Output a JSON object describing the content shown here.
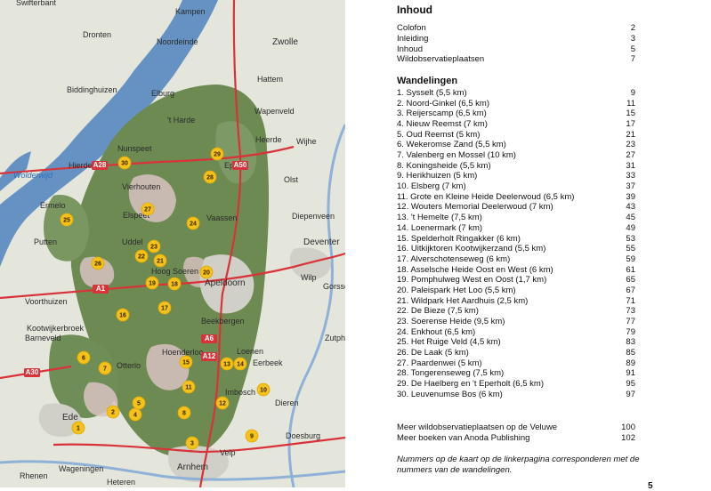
{
  "map": {
    "places": [
      "Swifterbant",
      "Kampen",
      "Dronten",
      "Noordeinde",
      "Zwolle",
      "Biddinghuizen",
      "Elburg",
      "Hattem",
      "'t Harde",
      "Wapenveld",
      "Nunspeet",
      "Heerde",
      "Wijhe",
      "Hierden",
      "Epe",
      "Wolderwijd",
      "Vierhouten",
      "Olst",
      "Ermelo",
      "Elspeet",
      "Vaassen",
      "Diepenveen",
      "Putten",
      "Uddel",
      "Deventer",
      "Hoog Soeren",
      "Apeldoorn",
      "Wilp",
      "Voorthuizen",
      "Gorsse",
      "Beekbergen",
      "Kootwijkerbroek",
      "Barneveld",
      "Hoenderloo",
      "Loenen",
      "Zutph",
      "Eerbeek",
      "Otterlo",
      "Imbosch",
      "Dieren",
      "Ede",
      "Doesburg",
      "Velp",
      "Wageningen",
      "Arnhem",
      "Rhenen",
      "Heteren"
    ],
    "roads": [
      "A28",
      "A50",
      "A1",
      "A30",
      "A12",
      "A6"
    ],
    "markers": [
      "1",
      "2",
      "3",
      "4",
      "5",
      "6",
      "7",
      "8",
      "9",
      "10",
      "11",
      "12",
      "13",
      "14",
      "15",
      "16",
      "17",
      "18",
      "19",
      "20",
      "21",
      "22",
      "23",
      "24",
      "25",
      "26",
      "27",
      "28",
      "29",
      "30"
    ],
    "colors": {
      "marker": "#f4c21b",
      "forest": "#6d8a53",
      "heath": "#d9c2c2",
      "water": "#4f82bd",
      "road": "#d9333a"
    }
  },
  "toc": {
    "title": "Inhoud",
    "front": [
      {
        "label": "Colofon",
        "page": "2"
      },
      {
        "label": "Inleiding",
        "page": "3"
      },
      {
        "label": "Inhoud",
        "page": "5"
      },
      {
        "label": "Wildobservatieplaatsen",
        "page": "7"
      }
    ],
    "walks_title": "Wandelingen",
    "walks": [
      {
        "label": "1. Sysselt (5,5 km)",
        "page": "9"
      },
      {
        "label": "2. Noord-Ginkel (6,5 km)",
        "page": "11"
      },
      {
        "label": "3. Reijerscamp (6,5 km)",
        "page": "15"
      },
      {
        "label": "4. Nieuw Reemst (7 km)",
        "page": "17"
      },
      {
        "label": "5. Oud Reemst  (5 km)",
        "page": "21"
      },
      {
        "label": "6. Wekeromse Zand (5,5 km)",
        "page": "23"
      },
      {
        "label": "7. Valenberg en Mossel (10 km)",
        "page": "27"
      },
      {
        "label": "8. Koningsheide (5,5 km)",
        "page": "31"
      },
      {
        "label": "9. Herikhuizen (5 km)",
        "page": "33"
      },
      {
        "label": "10. Elsberg (7 km)",
        "page": "37"
      },
      {
        "label": "11. Grote en Kleine Heide Deelerwoud (6,5 km)",
        "page": "39"
      },
      {
        "label": "12. Wouters Memorial Deelerwoud (7 km)",
        "page": "43"
      },
      {
        "label": "13. 't Hemelte (7,5 km)",
        "page": "45"
      },
      {
        "label": "14. Loenermark (7 km)",
        "page": "49"
      },
      {
        "label": "15. Spelderholt Ringakker (6 km)",
        "page": "53"
      },
      {
        "label": "16. Uitkijktoren Kootwijkerzand (5,5 km)",
        "page": "55"
      },
      {
        "label": "17. Alverschotenseweg (6 km)",
        "page": "59"
      },
      {
        "label": "18. Asselsche Heide Oost en West (6 km)",
        "page": "61"
      },
      {
        "label": "19. Pomphulweg West en Oost (1,7 km)",
        "page": "65"
      },
      {
        "label": "20. Paleispark Het Loo (5,5 km)",
        "page": "67"
      },
      {
        "label": "21. Wildpark Het Aardhuis (2,5 km)",
        "page": "71"
      },
      {
        "label": "22. De Bieze (7,5 km)",
        "page": "73"
      },
      {
        "label": "23. Soerense Heide (9,5 km)",
        "page": "77"
      },
      {
        "label": "24. Enkhout (6,5 km)",
        "page": "79"
      },
      {
        "label": "25. Het Ruige Veld (4,5 km)",
        "page": "83"
      },
      {
        "label": "26. De Laak (5 km)",
        "page": "85"
      },
      {
        "label": "27. Paardenwei (5 km)",
        "page": "89"
      },
      {
        "label": "28. Tongerenseweg (7,5 km)",
        "page": "91"
      },
      {
        "label": "29. De Haelberg en 't Eperholt (6,5 km)",
        "page": "95"
      },
      {
        "label": "30. Leuvenumse Bos (6 km)",
        "page": "97"
      }
    ],
    "extra": [
      {
        "label": "Meer wildobservatieplaatsen op de Veluwe",
        "page": "100"
      },
      {
        "label": "Meer boeken van Anoda Publishing",
        "page": "102"
      }
    ],
    "note": "Nummers op de kaart op de linkerpagina corresponderen met de nummers van de wandelingen.",
    "page_number": "5"
  }
}
